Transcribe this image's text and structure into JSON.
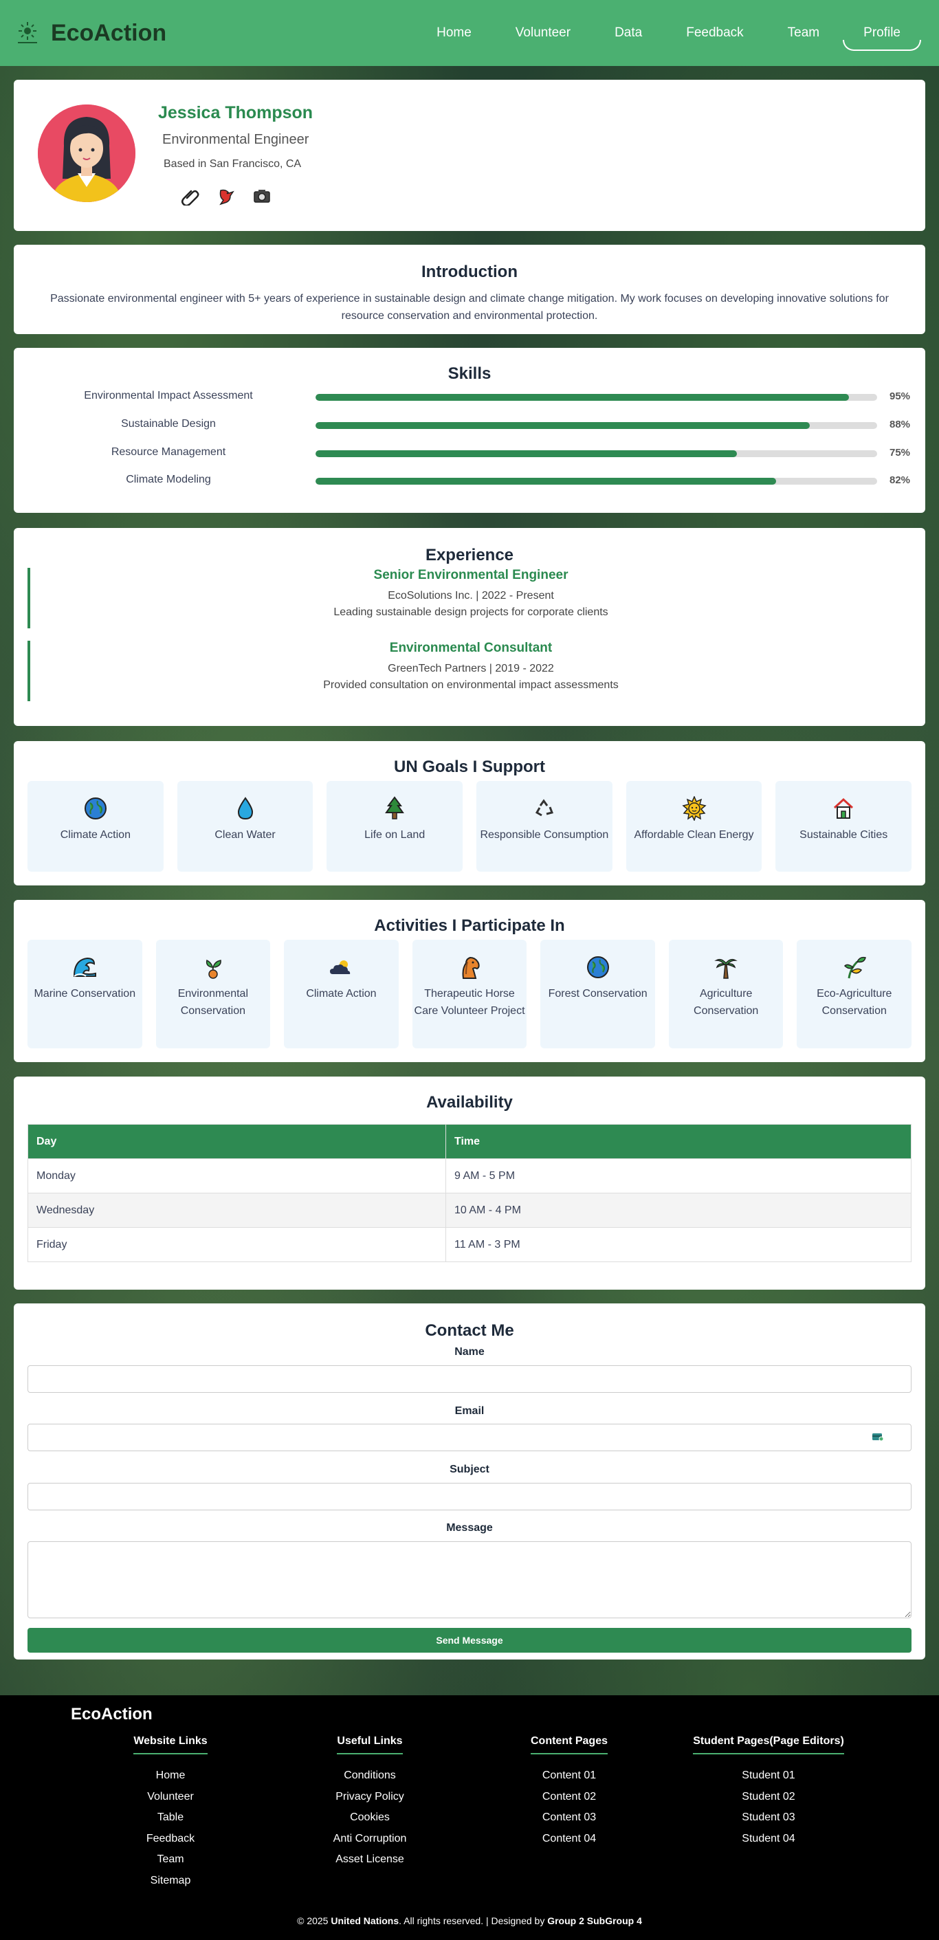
{
  "header": {
    "logo": "EcoAction",
    "nav": [
      "Home",
      "Volunteer",
      "Data",
      "Feedback",
      "Team",
      "Profile"
    ],
    "active": "Profile"
  },
  "profile": {
    "name": "Jessica Thompson",
    "role": "Environmental Engineer",
    "location": "Based in San Francisco, CA",
    "icons": [
      "paperclip-icon",
      "bird-icon",
      "camera-icon"
    ]
  },
  "intro": {
    "title": "Introduction",
    "text": "Passionate environmental engineer with 5+ years of experience in sustainable design and climate change mitigation. My work focuses on developing innovative solutions for resource conservation and environmental protection."
  },
  "skills": {
    "title": "Skills",
    "items": [
      {
        "name": "Environmental Impact Assessment",
        "percent": 95,
        "label": "95%"
      },
      {
        "name": "Sustainable Design",
        "percent": 88,
        "label": "88%"
      },
      {
        "name": "Resource Management",
        "percent": 75,
        "label": "75%"
      },
      {
        "name": "Climate Modeling",
        "percent": 82,
        "label": "82%"
      }
    ]
  },
  "experience": {
    "title": "Experience",
    "items": [
      {
        "title": "Senior Environmental Engineer",
        "line": "EcoSolutions Inc. | 2022 - Present",
        "desc": "Leading sustainable design projects for corporate clients"
      },
      {
        "title": "Environmental Consultant",
        "line": "GreenTech Partners | 2019 - 2022",
        "desc": "Provided consultation on environmental impact assessments"
      }
    ]
  },
  "goals": {
    "title": "UN Goals I Support",
    "items": [
      {
        "label": "Climate Action",
        "icon": "globe-icon"
      },
      {
        "label": "Clean Water",
        "icon": "droplet-icon"
      },
      {
        "label": "Life on Land",
        "icon": "tree-icon"
      },
      {
        "label": "Responsible Consumption",
        "icon": "recycle-icon"
      },
      {
        "label": "Affordable Clean Energy",
        "icon": "sun-icon"
      },
      {
        "label": "Sustainable Cities",
        "icon": "house-icon"
      }
    ]
  },
  "activities": {
    "title": "Activities I Participate In",
    "items": [
      {
        "label": "Marine Conservation",
        "icon": "wave-icon"
      },
      {
        "label": "Environmental Conservation",
        "icon": "sprout-icon"
      },
      {
        "label": "Climate Action",
        "icon": "cloud-sun-icon"
      },
      {
        "label": "Therapeutic Horse Care Volunteer Project",
        "icon": "horse-icon"
      },
      {
        "label": "Forest Conservation",
        "icon": "globe-icon"
      },
      {
        "label": "Agriculture Conservation",
        "icon": "palm-tree-icon"
      },
      {
        "label": "Eco-Agriculture Conservation",
        "icon": "plant-icon"
      }
    ]
  },
  "availability": {
    "title": "Availability",
    "headers": [
      "Day",
      "Time"
    ],
    "rows": [
      [
        "Monday",
        "9 AM - 5 PM"
      ],
      [
        "Wednesday",
        "10 AM - 4 PM"
      ],
      [
        "Friday",
        "11 AM - 3 PM"
      ]
    ]
  },
  "contact": {
    "title": "Contact Me",
    "name_label": "Name",
    "email_label": "Email",
    "subject_label": "Subject",
    "message_label": "Message",
    "send_label": "Send Message"
  },
  "footer": {
    "brand": "EcoAction",
    "columns": [
      {
        "title": "Website Links",
        "links": [
          "Home",
          "Volunteer",
          "Table",
          "Feedback",
          "Team",
          "Sitemap"
        ]
      },
      {
        "title": "Useful Links",
        "links": [
          "Conditions",
          "Privacy Policy",
          "Cookies",
          "Anti Corruption",
          "Asset License"
        ]
      },
      {
        "title": "Content Pages",
        "links": [
          "Content 01",
          "Content 02",
          "Content 03",
          "Content 04"
        ]
      },
      {
        "title": "Student Pages(Page Editors)",
        "links": [
          "Student 01",
          "Student 02",
          "Student 03",
          "Student 04"
        ]
      }
    ],
    "copy_prefix": "© 2025",
    "copy_org": "United Nations",
    "copy_mid": ". All rights reserved. | Designed by",
    "copy_team": "Group 2 SubGroup 4"
  },
  "colors": {
    "brand": "#4bb071",
    "accent": "#2e8a52"
  }
}
